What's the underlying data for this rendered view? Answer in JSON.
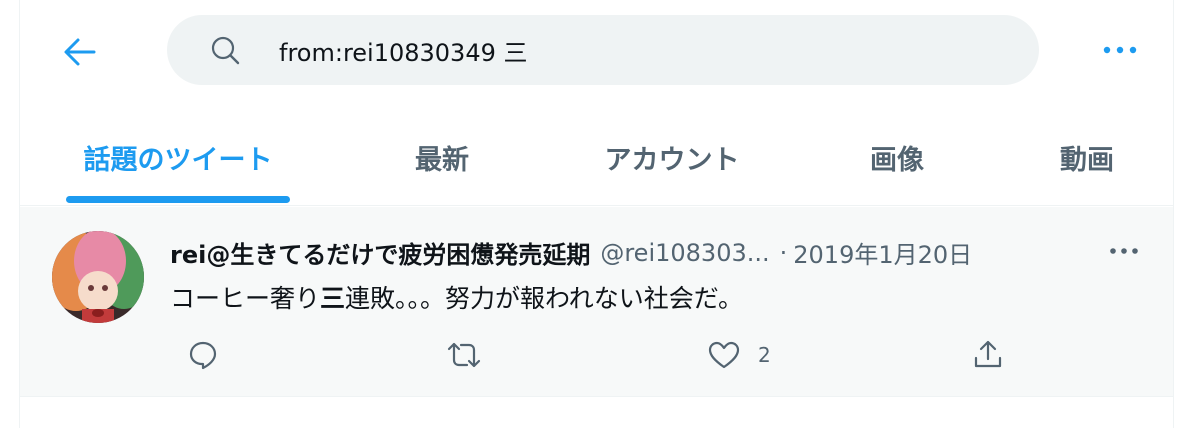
{
  "search": {
    "query": "from:rei10830349 三"
  },
  "tabs": [
    {
      "label": "話題のツイート",
      "active": true
    },
    {
      "label": "最新"
    },
    {
      "label": "アカウント"
    },
    {
      "label": "画像"
    },
    {
      "label": "動画"
    }
  ],
  "tweet": {
    "display_name": "rei@生きてるだけで疲労困憊発売延期",
    "handle": "@rei108303...",
    "separator": "·",
    "date": "2019年1月20日",
    "text_before": "コーヒー奢り",
    "text_highlight": "三",
    "text_after": "連敗。。。努力が報われない社会だ。",
    "like_count": "2"
  },
  "colors": {
    "accent": "#1d9bf0",
    "secondary_text": "#536471",
    "primary_text": "#0f1419",
    "search_bg": "#eff3f4"
  },
  "icons": [
    "back-arrow-icon",
    "search-icon",
    "more-icon",
    "reply-icon",
    "retweet-icon",
    "like-icon",
    "share-icon"
  ]
}
